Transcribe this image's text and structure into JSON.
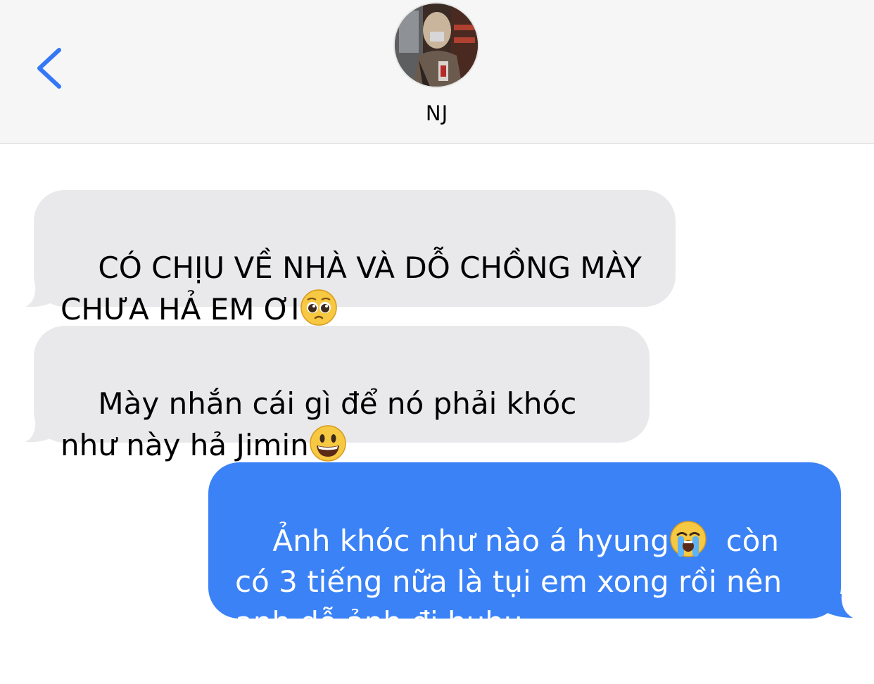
{
  "header": {
    "back_label": "Back",
    "contact_name": "NJ"
  },
  "messages": [
    {
      "direction": "incoming",
      "text": "CÓ CHỊU VỀ NHÀ VÀ DỖ CHỒNG MÀY CHƯA HẢ EM ƠI",
      "emoji": "pleading-face-icon"
    },
    {
      "direction": "incoming",
      "text": "Mày nhắn cái gì để nó phải khóc như này hả Jimin",
      "emoji": "grinning-face-icon"
    },
    {
      "direction": "outgoing",
      "text_before": "Ảnh khóc như nào á hyung",
      "emoji": "loudly-crying-face-icon",
      "text_after": "  còn có 3 tiếng nữa là tụi em xong rồi nên anh dỗ ảnh đi huhu"
    }
  ],
  "colors": {
    "incoming_bubble": "#e9e9eb",
    "outgoing_bubble": "#3b82f6",
    "accent": "#3478f6"
  }
}
